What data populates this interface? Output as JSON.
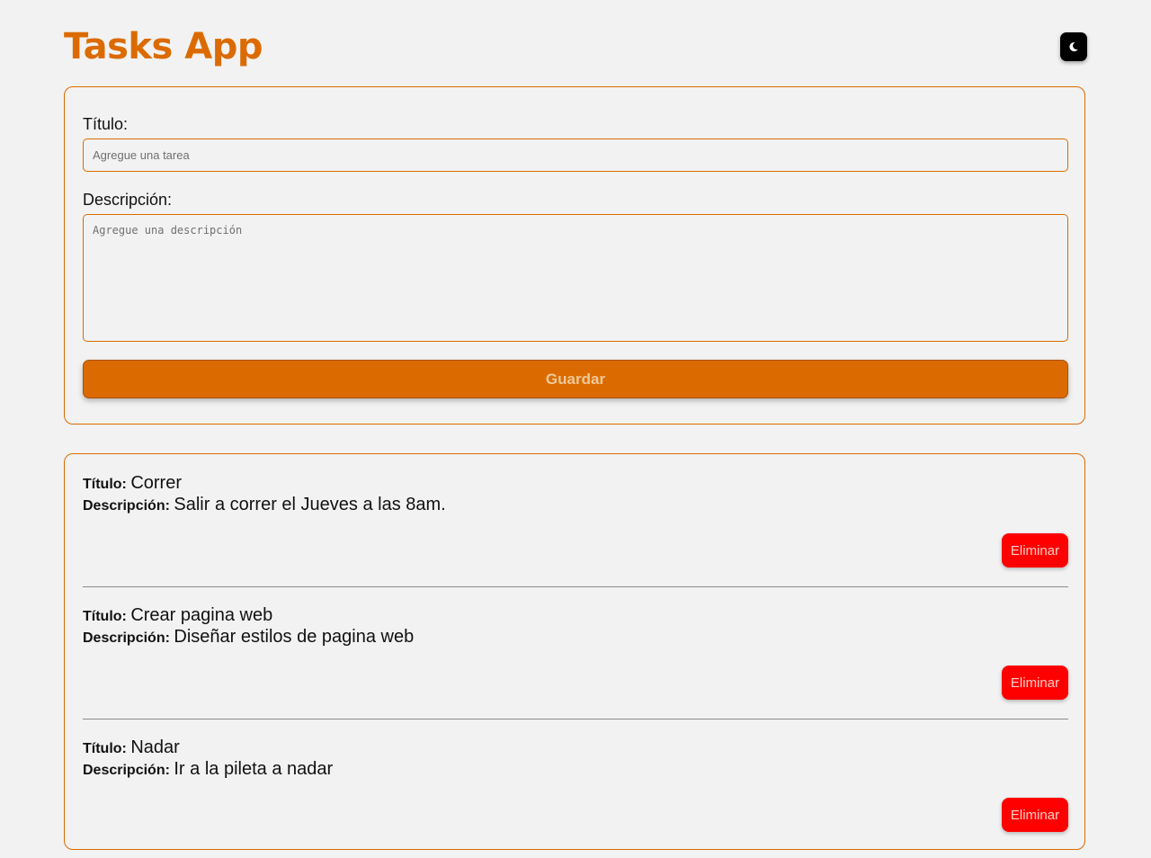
{
  "app": {
    "title": "Tasks App",
    "theme_toggle_icon": "moon-icon",
    "accent_color": "#db6b00"
  },
  "form": {
    "title_label": "Título:",
    "title_placeholder": "Agregue una tarea",
    "title_value": "",
    "description_label": "Descripción:",
    "description_placeholder": "Agregue una descripción",
    "description_value": "",
    "save_label": "Guardar"
  },
  "tasks": {
    "title_key": "Título:",
    "description_key": "Descripción:",
    "delete_label": "Eliminar",
    "delete_color": "#ff0000",
    "items": [
      {
        "title": "Correr",
        "description": "Salir a correr el Jueves a las 8am."
      },
      {
        "title": "Crear pagina web",
        "description": "Diseñar estilos de pagina web"
      },
      {
        "title": "Nadar",
        "description": "Ir a la pileta a nadar"
      }
    ]
  }
}
